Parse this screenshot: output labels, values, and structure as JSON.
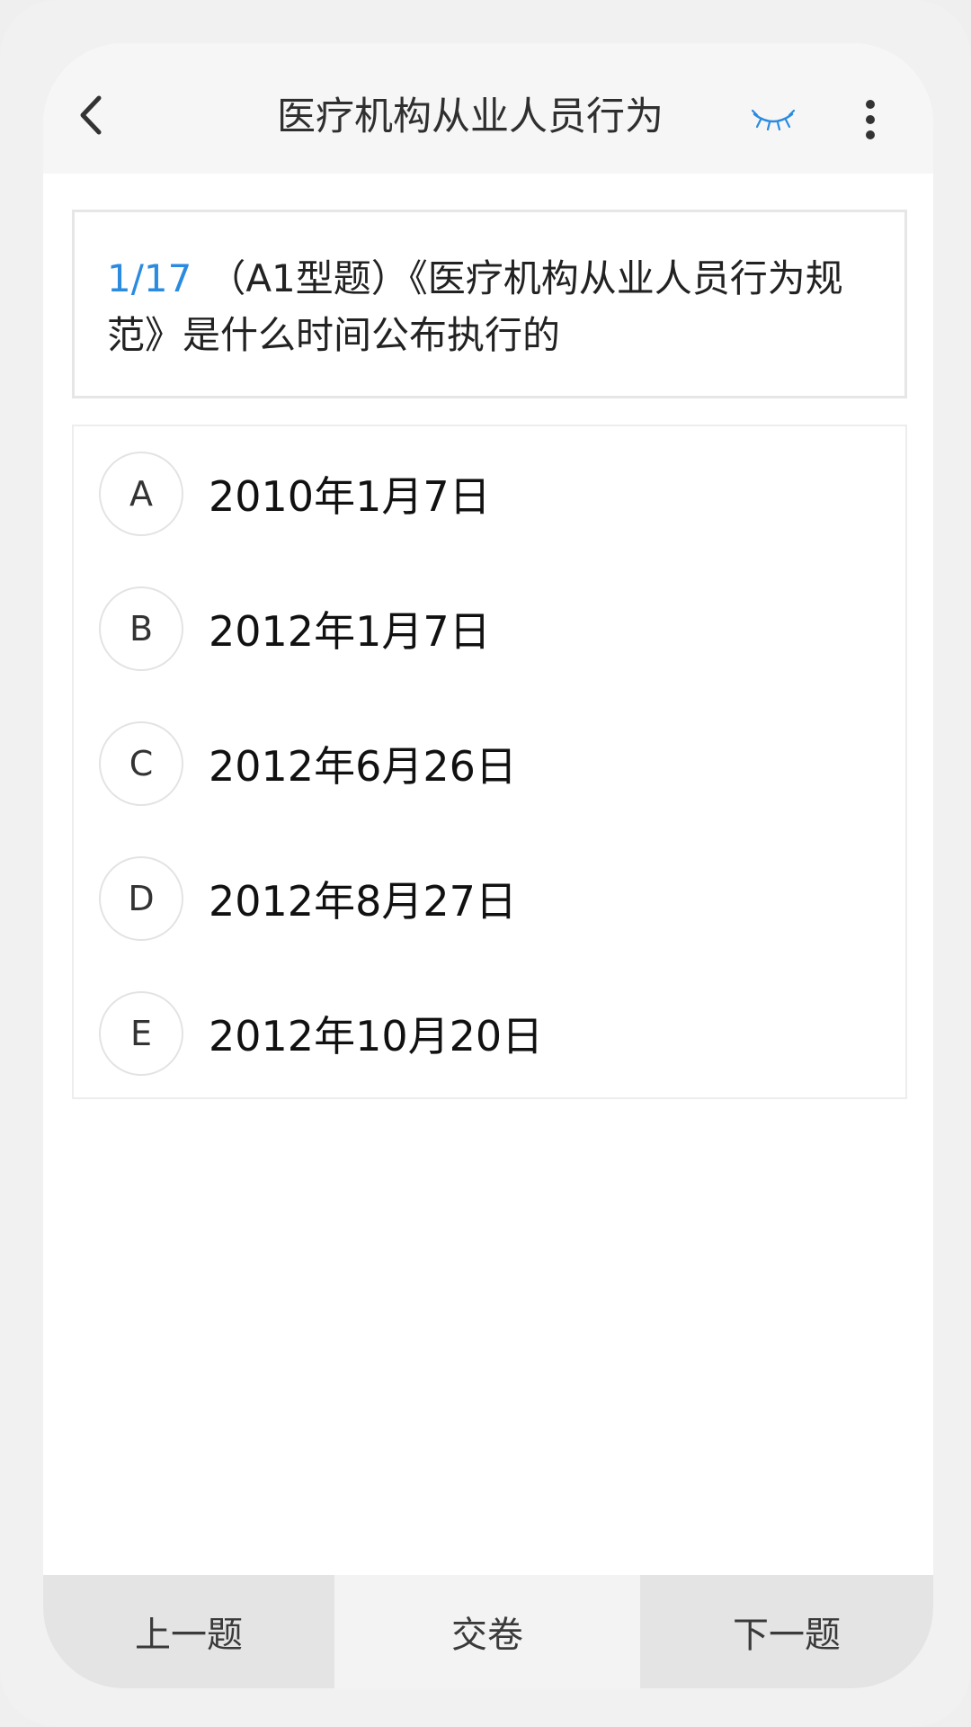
{
  "header": {
    "title": "医疗机构从业人员行为",
    "back_icon": "chevron-left-icon",
    "eye_icon": "eye-closed-icon",
    "more_icon": "more-vertical-icon",
    "accent_color": "#2a8be0"
  },
  "question": {
    "index": "1/17",
    "text": "（A1型题）《医疗机构从业人员行为规范》是什么时间公布执行的"
  },
  "options": [
    {
      "letter": "A",
      "text": "2010年1月7日"
    },
    {
      "letter": "B",
      "text": "2012年1月7日"
    },
    {
      "letter": "C",
      "text": "2012年6月26日"
    },
    {
      "letter": "D",
      "text": "2012年8月27日"
    },
    {
      "letter": "E",
      "text": "2012年10月20日"
    }
  ],
  "footer": {
    "prev_label": "上一题",
    "submit_label": "交卷",
    "next_label": "下一题"
  }
}
